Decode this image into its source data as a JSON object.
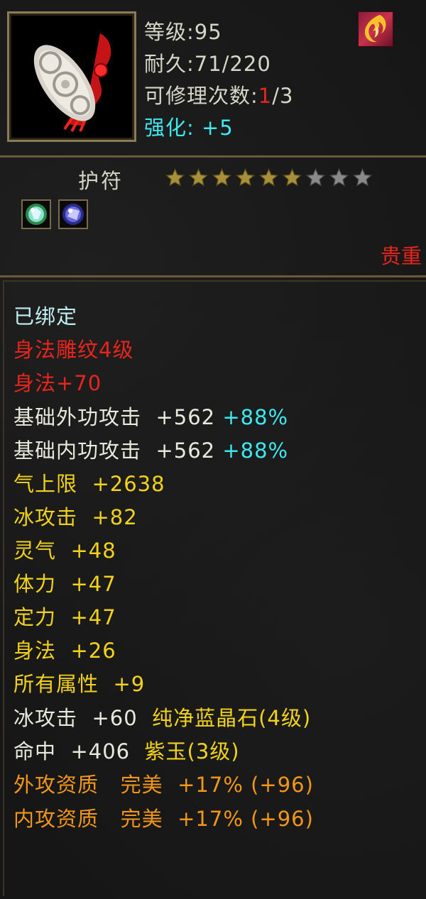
{
  "header": {
    "level_label": "等级:",
    "level_value": "95",
    "durability_label": "耐久:",
    "durability_value": "71/220",
    "repair_label": "可修理次数:",
    "repair_used": "1",
    "repair_total": "/3",
    "enhance_label": "强化:",
    "enhance_value": "+5",
    "item_icon": "jade-amulet-with-red-tassel-icon",
    "badge_icon": "flame-rune-badge-icon"
  },
  "item": {
    "type_label": "护符",
    "stars_filled": 6,
    "stars_total": 9,
    "gem_sockets": [
      "green-crystal-gem-icon",
      "blue-crystal-gem-icon"
    ],
    "rarity_label": "贵重"
  },
  "attributes": {
    "bound": "已绑定",
    "engrave": "身法雕纹4级",
    "engrave_bonus": "身法+70",
    "rows": [
      {
        "label": "基础外功攻击",
        "value": "+562",
        "extra": "+88%"
      },
      {
        "label": "基础内功攻击",
        "value": "+562",
        "extra": "+88%"
      },
      {
        "label": "气上限",
        "value": "+2638"
      },
      {
        "label": "冰攻击",
        "value": "+82"
      },
      {
        "label": "灵气",
        "value": "+48"
      },
      {
        "label": "体力",
        "value": "+47"
      },
      {
        "label": "定力",
        "value": "+47"
      },
      {
        "label": "身法",
        "value": "+26"
      },
      {
        "label": "所有属性",
        "value": "+9"
      }
    ],
    "gem_rows": [
      {
        "label": "冰攻击",
        "value": "+60",
        "gem": "纯净蓝晶石(4级)"
      },
      {
        "label": "命中",
        "value": "+406",
        "gem": "紫玉(3级)"
      }
    ],
    "aptitude_rows": [
      {
        "label": "外攻资质",
        "quality": "完美",
        "value": "+17%",
        "extra": "(+96)"
      },
      {
        "label": "内攻资质",
        "quality": "完美",
        "value": "+17%",
        "extra": "(+96)"
      }
    ]
  },
  "colors": {
    "frame": "#8a7a55",
    "cyan": "#3ee8f0",
    "red": "#e8251c",
    "yellow": "#f2d21a",
    "orange": "#f2961a"
  }
}
